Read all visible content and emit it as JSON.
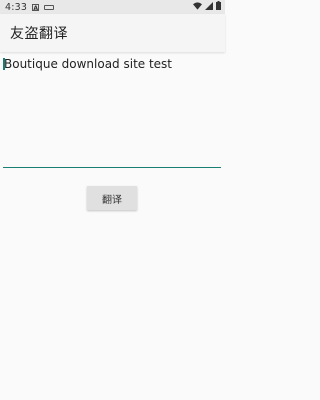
{
  "status_bar": {
    "time": "4:33",
    "icons": [
      "a-notification-icon",
      "keyboard-icon",
      "wifi-icon",
      "signal-icon",
      "battery-icon"
    ]
  },
  "app_bar": {
    "title": "友盗翻译"
  },
  "input": {
    "value": "Boutique download site test"
  },
  "translate_button": {
    "label": "翻译"
  },
  "colors": {
    "accent": "#1a7f73",
    "button_bg": "#e0e0e0",
    "background": "#fafafa"
  }
}
